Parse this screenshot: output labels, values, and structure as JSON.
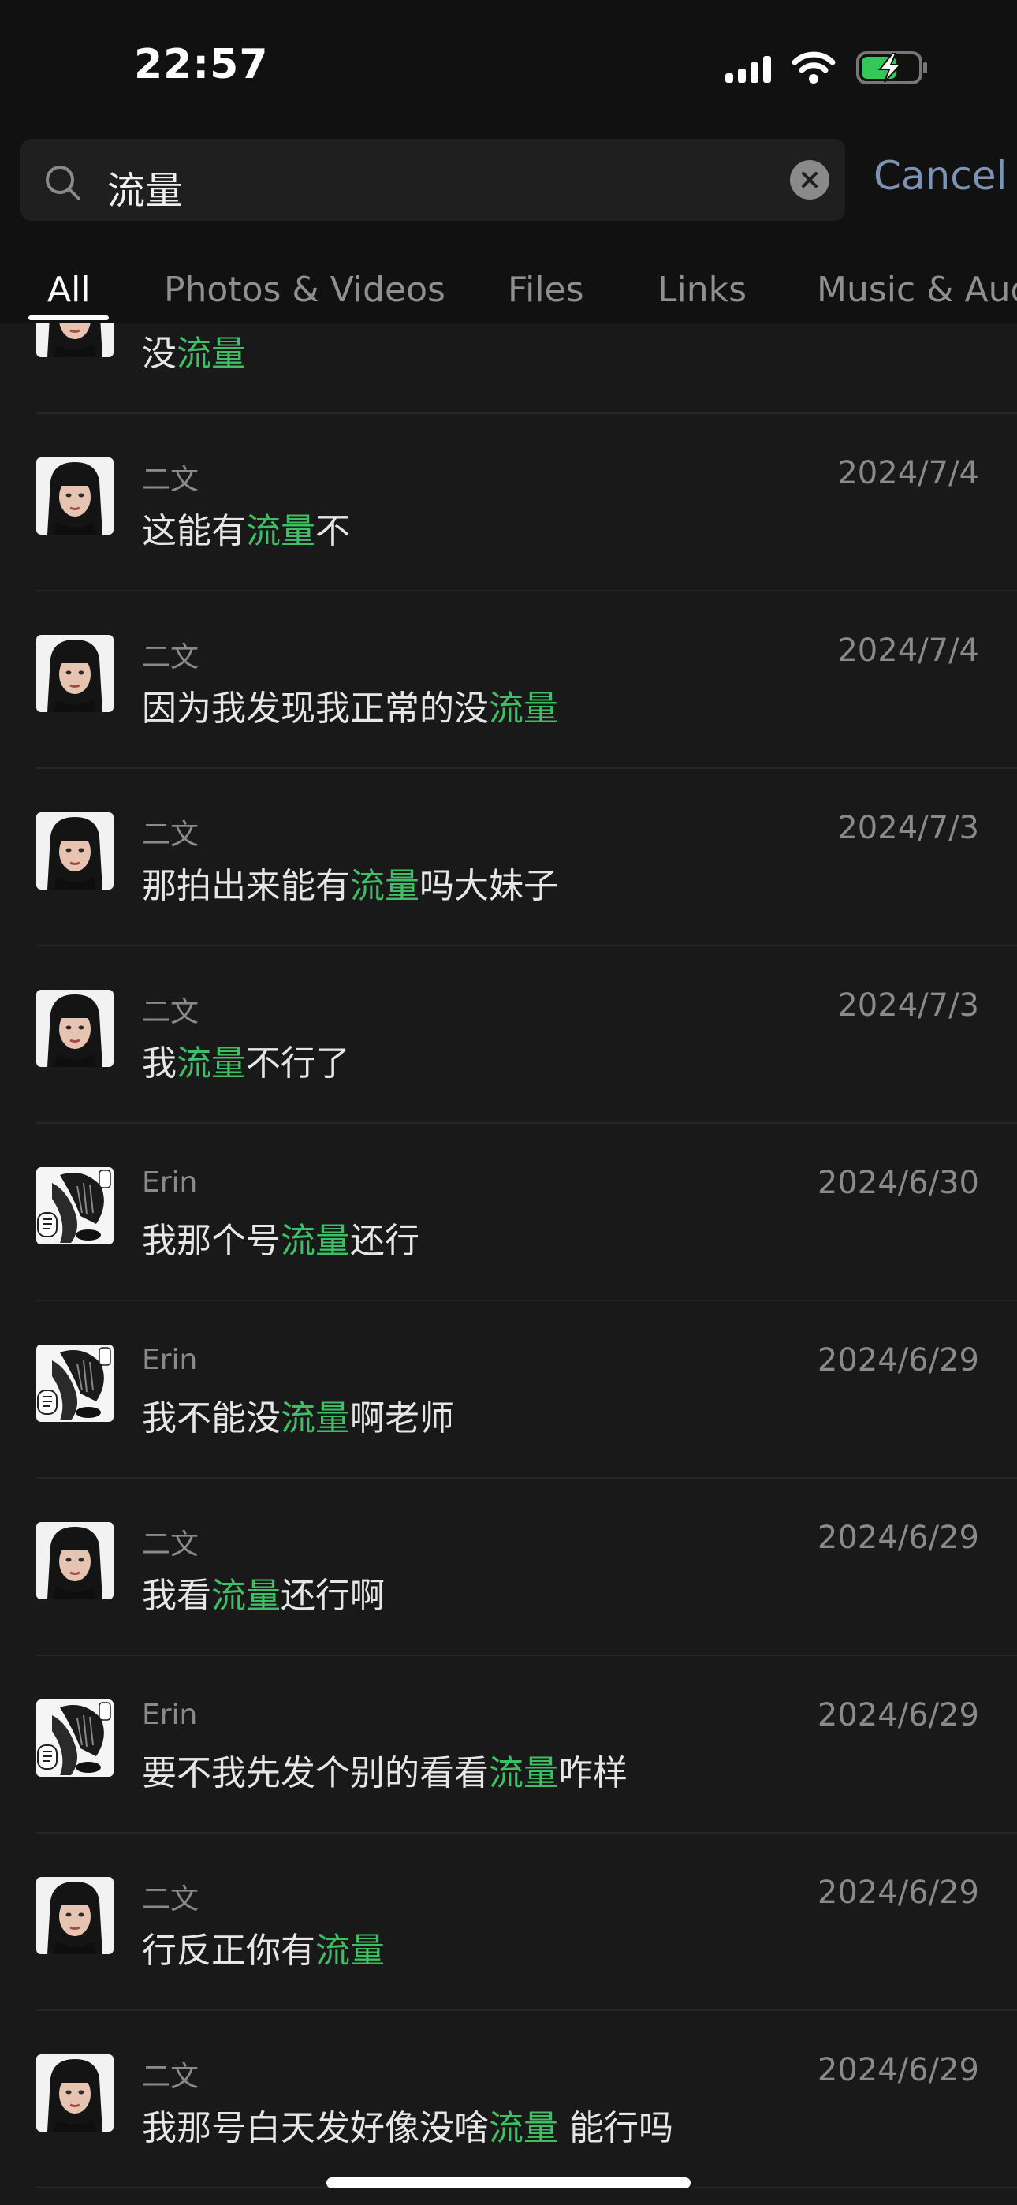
{
  "status_bar": {
    "time": "22:57"
  },
  "search": {
    "query": "流量",
    "cancel_label": "Cancel"
  },
  "tabs": [
    {
      "label": "All",
      "active": true
    },
    {
      "label": "Photos & Videos",
      "active": false
    },
    {
      "label": "Files",
      "active": false
    },
    {
      "label": "Links",
      "active": false
    },
    {
      "label": "Music & Aud",
      "active": false
    }
  ],
  "results": [
    {
      "sender": "",
      "date": "",
      "avatar": "girl-avatar",
      "before": "没",
      "match": "流量",
      "after": ""
    },
    {
      "sender": "二文",
      "date": "2024/7/4",
      "avatar": "girl-avatar",
      "before": "这能有",
      "match": "流量",
      "after": "不"
    },
    {
      "sender": "二文",
      "date": "2024/7/4",
      "avatar": "girl-avatar",
      "before": "因为我发现我正常的没",
      "match": "流量",
      "after": ""
    },
    {
      "sender": "二文",
      "date": "2024/7/3",
      "avatar": "girl-avatar",
      "before": "那拍出来能有",
      "match": "流量",
      "after": "吗大妹子"
    },
    {
      "sender": "二文",
      "date": "2024/7/3",
      "avatar": "girl-avatar",
      "before": "我",
      "match": "流量",
      "after": "不行了"
    },
    {
      "sender": "Erin",
      "date": "2024/6/30",
      "avatar": "manga-avatar",
      "before": "我那个号",
      "match": "流量",
      "after": "还行"
    },
    {
      "sender": "Erin",
      "date": "2024/6/29",
      "avatar": "manga-avatar",
      "before": "我不能没",
      "match": "流量",
      "after": "啊老师"
    },
    {
      "sender": "二文",
      "date": "2024/6/29",
      "avatar": "girl-avatar",
      "before": "我看",
      "match": "流量",
      "after": "还行啊"
    },
    {
      "sender": "Erin",
      "date": "2024/6/29",
      "avatar": "manga-avatar",
      "before": "要不我先发个别的看看",
      "match": "流量",
      "after": "咋样"
    },
    {
      "sender": "二文",
      "date": "2024/6/29",
      "avatar": "girl-avatar",
      "before": "行反正你有",
      "match": "流量",
      "after": ""
    },
    {
      "sender": "二文",
      "date": "2024/6/29",
      "avatar": "girl-avatar",
      "before": "我那号白天发好像没啥",
      "match": "流量",
      "after": " 能行吗"
    }
  ],
  "colors": {
    "highlight": "#3fbf65",
    "cancel": "#7d93b5",
    "background": "#191919"
  }
}
